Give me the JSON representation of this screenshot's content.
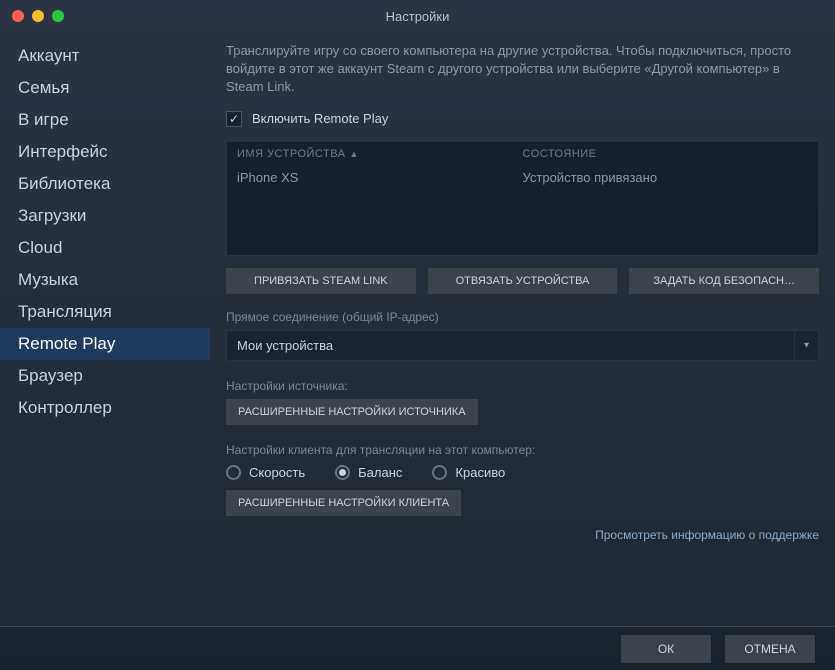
{
  "window": {
    "title": "Настройки"
  },
  "sidebar": {
    "items": [
      {
        "label": "Аккаунт",
        "selected": false
      },
      {
        "label": "Семья",
        "selected": false
      },
      {
        "label": "В игре",
        "selected": false
      },
      {
        "label": "Интерфейс",
        "selected": false
      },
      {
        "label": "Библиотека",
        "selected": false
      },
      {
        "label": "Загрузки",
        "selected": false
      },
      {
        "label": "Cloud",
        "selected": false
      },
      {
        "label": "Музыка",
        "selected": false
      },
      {
        "label": "Трансляция",
        "selected": false
      },
      {
        "label": "Remote Play",
        "selected": true
      },
      {
        "label": "Браузер",
        "selected": false
      },
      {
        "label": "Контроллер",
        "selected": false
      }
    ]
  },
  "main": {
    "intro": "Транслируйте игру со своего компьютера на другие устройства. Чтобы подключиться, просто войдите в этот же аккаунт Steam с другого устройства или выберите «Другой компьютер» в Steam Link.",
    "enable_label": "Включить Remote Play",
    "enable_checked": true,
    "devices": {
      "col_name": "ИМЯ УСТРОЙСТВА",
      "col_status": "СОСТОЯНИЕ",
      "rows": [
        {
          "name": "iPhone XS",
          "status": "Устройство привязано"
        }
      ]
    },
    "buttons": {
      "pair": "ПРИВЯЗАТЬ STEAM LINK",
      "unpair": "ОТВЯЗАТЬ УСТРОЙСТВА",
      "set_pin": "ЗАДАТЬ КОД БЕЗОПАСН…"
    },
    "direct_conn_label": "Прямое соединение (общий IP-адрес)",
    "direct_conn_value": "Мои устройства",
    "source_section_label": "Настройки источника:",
    "source_advanced": "РАСШИРЕННЫЕ НАСТРОЙКИ ИСТОЧНИКА",
    "client_section_label": "Настройки клиента для трансляции на этот компьютер:",
    "quality": {
      "options": [
        {
          "label": "Скорость",
          "checked": false
        },
        {
          "label": "Баланс",
          "checked": true
        },
        {
          "label": "Красиво",
          "checked": false
        }
      ]
    },
    "client_advanced": "РАСШИРЕННЫЕ НАСТРОЙКИ КЛИЕНТА",
    "support_link": "Просмотреть информацию о поддержке"
  },
  "footer": {
    "ok": "ОК",
    "cancel": "ОТМЕНА"
  }
}
